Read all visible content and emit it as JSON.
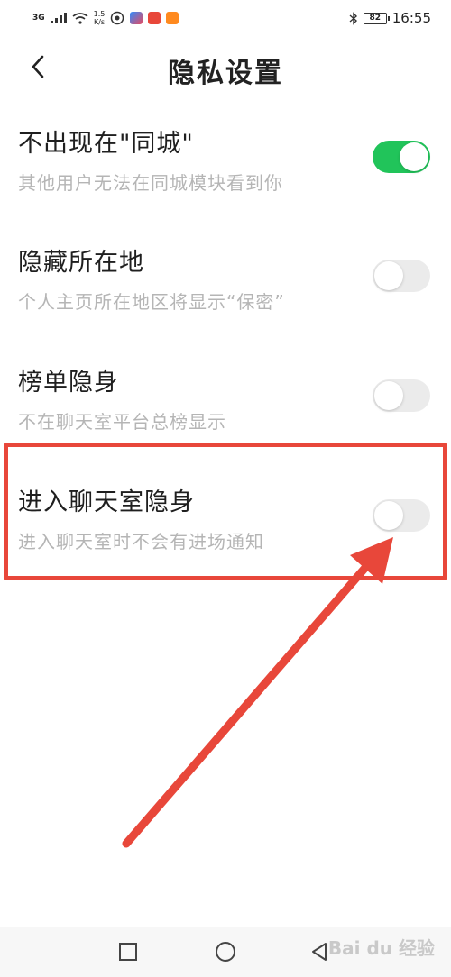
{
  "status_bar": {
    "network": "3G",
    "speed_value": "1.5",
    "speed_unit": "K/s",
    "battery": "82",
    "time": "16:55"
  },
  "header": {
    "title": "隐私设置"
  },
  "settings": [
    {
      "title": "不出现在\"同城\"",
      "description": "其他用户无法在同城模块看到你",
      "enabled": true
    },
    {
      "title": "隐藏所在地",
      "description": "个人主页所在地区将显示“保密”",
      "enabled": false
    },
    {
      "title": "榜单隐身",
      "description": "不在聊天室平台总榜显示",
      "enabled": false
    },
    {
      "title": "进入聊天室隐身",
      "description": "进入聊天室时不会有进场通知",
      "enabled": false
    }
  ],
  "colors": {
    "toggle_on": "#21c45a",
    "toggle_off": "#ebebeb",
    "annotation": "#e8473a"
  },
  "watermark": "Bai du 经验"
}
